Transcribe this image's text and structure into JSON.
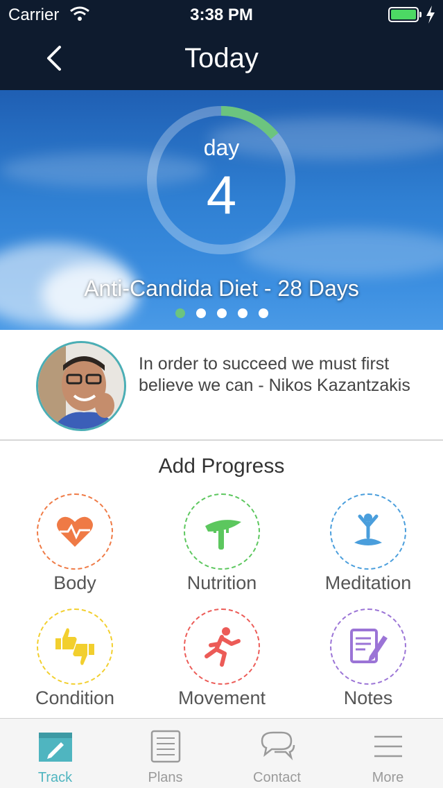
{
  "status_bar": {
    "carrier": "Carrier",
    "time": "3:38 PM",
    "battery_color": "#4cd964"
  },
  "nav": {
    "title": "Today",
    "back_icon": "chevron-left-icon"
  },
  "hero": {
    "day_label": "day",
    "day_number": "4",
    "plan_title": "Anti-Candida Diet - 28 Days",
    "progress_fraction": 0.14,
    "progress_color": "#6cc47f",
    "page_dots": 5,
    "active_dot": 0
  },
  "quote": {
    "text": "In order to succeed we must first believe we can - Nikos Kazantzakis",
    "accent_color": "#4aaeb5"
  },
  "add_progress": {
    "title": "Add Progress",
    "items": [
      {
        "label": "Body",
        "icon": "heart-pulse-icon",
        "color": "#ef7a45"
      },
      {
        "label": "Nutrition",
        "icon": "fork-carrot-icon",
        "color": "#5cc75e"
      },
      {
        "label": "Meditation",
        "icon": "meditation-icon",
        "color": "#4a9edc"
      },
      {
        "label": "Condition",
        "icon": "thumbs-up-down-icon",
        "color": "#f2cf2e"
      },
      {
        "label": "Movement",
        "icon": "running-person-icon",
        "color": "#ec5b57"
      },
      {
        "label": "Notes",
        "icon": "notepad-pencil-icon",
        "color": "#9b74d6"
      }
    ]
  },
  "tabbar": {
    "active_color": "#4fb5c0",
    "tabs": [
      {
        "label": "Track",
        "icon": "calendar-pencil-icon"
      },
      {
        "label": "Plans",
        "icon": "list-document-icon"
      },
      {
        "label": "Contact",
        "icon": "chat-bubbles-icon"
      },
      {
        "label": "More",
        "icon": "menu-lines-icon"
      }
    ]
  }
}
